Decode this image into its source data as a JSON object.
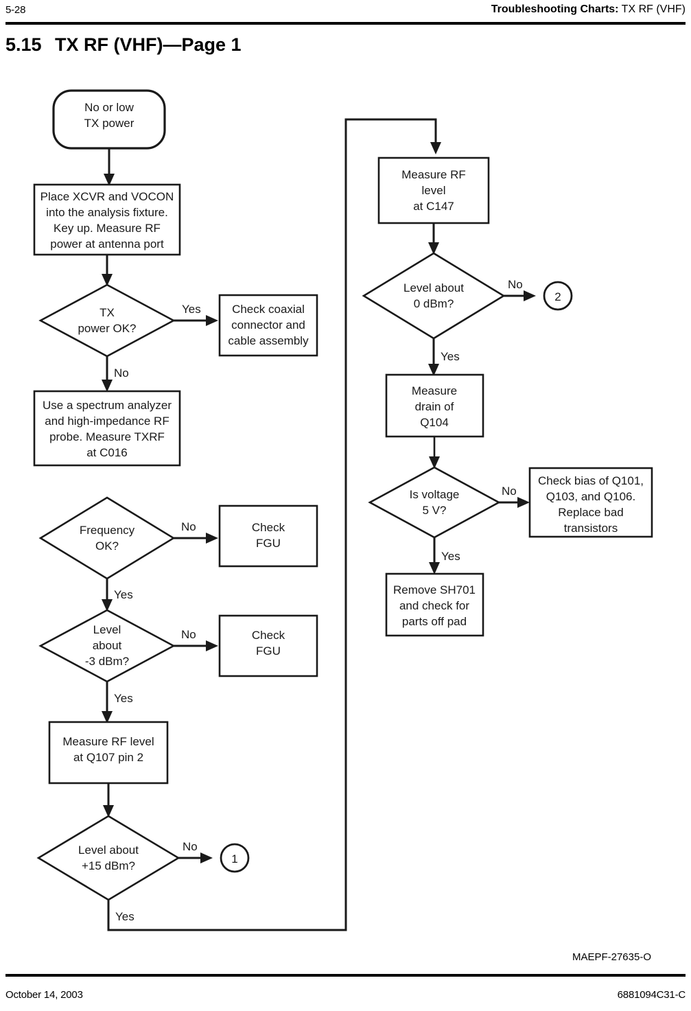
{
  "header": {
    "page_number": "5-28",
    "chapter_label": "Troubleshooting Charts:",
    "chapter_topic": " TX RF (VHF)"
  },
  "section": {
    "number": "5.15",
    "title": "TX RF (VHF)—Page 1"
  },
  "artwork_code": "MAEPF-27635-O",
  "footer": {
    "date": "October 14, 2003",
    "document_number": "6881094C31-C"
  },
  "chart_data": {
    "type": "diagram",
    "title": "TX RF (VHF)—Page 1",
    "nodes": [
      {
        "id": "start",
        "shape": "terminator",
        "lines": [
          "No or low",
          "TX power"
        ]
      },
      {
        "id": "place",
        "shape": "process",
        "lines": [
          "Place XCVR and VOCON",
          "into the analysis fixture.",
          "Key up. Measure RF",
          "power at antenna port"
        ]
      },
      {
        "id": "txpower",
        "shape": "decision",
        "lines": [
          "TX",
          "power OK?"
        ]
      },
      {
        "id": "coax",
        "shape": "process",
        "lines": [
          "Check coaxial",
          "connector and",
          "cable assembly"
        ]
      },
      {
        "id": "spectrum",
        "shape": "process",
        "lines": [
          "Use a spectrum analyzer",
          "and high-impedance RF",
          "probe. Measure TXRF",
          "at C016"
        ]
      },
      {
        "id": "freq",
        "shape": "decision",
        "lines": [
          "Frequency",
          "OK?"
        ]
      },
      {
        "id": "fgu1",
        "shape": "process",
        "lines": [
          "Check",
          "FGU"
        ]
      },
      {
        "id": "levelneg3",
        "shape": "decision",
        "lines": [
          "Level",
          "about",
          "-3 dBm?"
        ]
      },
      {
        "id": "fgu2",
        "shape": "process",
        "lines": [
          "Check",
          "FGU"
        ]
      },
      {
        "id": "q107",
        "shape": "process",
        "lines": [
          "Measure RF level",
          "at Q107 pin 2"
        ]
      },
      {
        "id": "levelplus15",
        "shape": "decision",
        "lines": [
          "Level about",
          "+15 dBm?"
        ]
      },
      {
        "id": "conn1",
        "shape": "connector",
        "lines": [
          "1"
        ]
      },
      {
        "id": "c147",
        "shape": "process",
        "lines": [
          "Measure RF",
          "level",
          "at C147"
        ]
      },
      {
        "id": "level0",
        "shape": "decision",
        "lines": [
          "Level about",
          "0 dBm?"
        ]
      },
      {
        "id": "conn2",
        "shape": "connector",
        "lines": [
          "2"
        ]
      },
      {
        "id": "drain",
        "shape": "process",
        "lines": [
          "Measure",
          "drain of",
          "Q104"
        ]
      },
      {
        "id": "volt5",
        "shape": "decision",
        "lines": [
          "Is voltage",
          "5 V?"
        ]
      },
      {
        "id": "bias",
        "shape": "process",
        "lines": [
          "Check bias of Q101,",
          "Q103, and Q106.",
          "Replace bad",
          "transistors"
        ]
      },
      {
        "id": "sh701",
        "shape": "process",
        "lines": [
          "Remove SH701",
          "and check for",
          "parts off pad"
        ]
      }
    ],
    "edges": [
      {
        "from": "start",
        "to": "place",
        "label": ""
      },
      {
        "from": "place",
        "to": "txpower",
        "label": ""
      },
      {
        "from": "txpower",
        "to": "coax",
        "label": "Yes"
      },
      {
        "from": "txpower",
        "to": "spectrum",
        "label": "No"
      },
      {
        "from": "freq",
        "to": "fgu1",
        "label": "No"
      },
      {
        "from": "freq",
        "to": "levelneg3",
        "label": "Yes"
      },
      {
        "from": "levelneg3",
        "to": "fgu2",
        "label": "No"
      },
      {
        "from": "levelneg3",
        "to": "q107",
        "label": "Yes"
      },
      {
        "from": "q107",
        "to": "levelplus15",
        "label": ""
      },
      {
        "from": "levelplus15",
        "to": "conn1",
        "label": "No"
      },
      {
        "from": "levelplus15",
        "to": "c147",
        "label": "Yes"
      },
      {
        "from": "c147",
        "to": "level0",
        "label": ""
      },
      {
        "from": "level0",
        "to": "conn2",
        "label": "No"
      },
      {
        "from": "level0",
        "to": "drain",
        "label": "Yes"
      },
      {
        "from": "drain",
        "to": "volt5",
        "label": ""
      },
      {
        "from": "volt5",
        "to": "bias",
        "label": "No"
      },
      {
        "from": "volt5",
        "to": "sh701",
        "label": "Yes"
      }
    ],
    "labels": {
      "yes": "Yes",
      "no": "No"
    }
  }
}
